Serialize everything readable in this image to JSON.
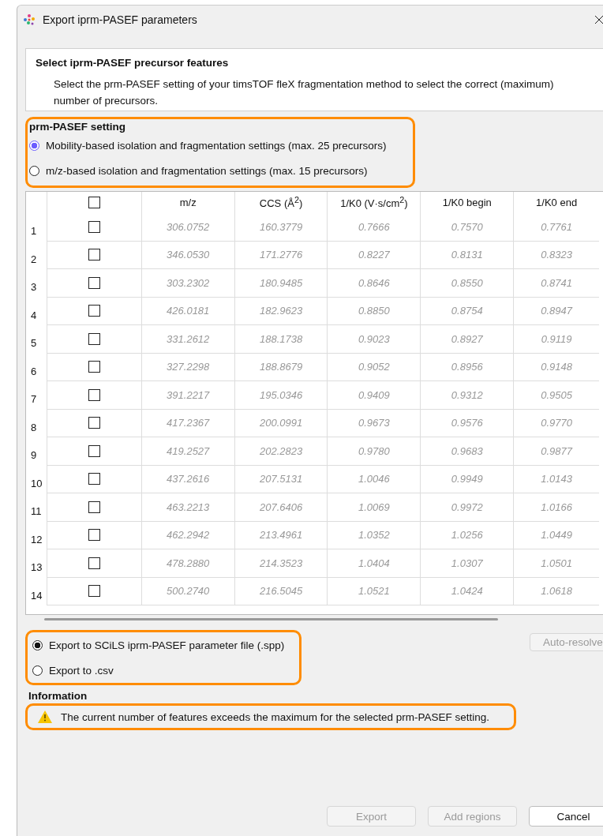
{
  "window": {
    "title": "Export iprm-PASEF parameters"
  },
  "header": {
    "title": "Select iprm-PASEF precursor features",
    "description": "Select the prm-PASEF setting of your timsTOF fleX fragmentation method to select the correct (maximum) number of precursors."
  },
  "setting": {
    "label": "prm-PASEF setting",
    "options": [
      {
        "label": "Mobility-based isolation and fragmentation settings (max. 25 precursors)",
        "selected": true
      },
      {
        "label": "m/z-based isolation and fragmentation settings (max. 15 precursors)",
        "selected": false
      }
    ]
  },
  "table": {
    "select_all_checked": false,
    "columns": [
      "m/z",
      "CCS (Å$^{2}$)",
      "1/K0 (V·s/cm$^{2}$)",
      "1/K0 begin",
      "1/K0 end"
    ],
    "rows": [
      {
        "index": "1",
        "checked": false,
        "cells": [
          "306.0752",
          "160.3779",
          "0.7666",
          "0.7570",
          "0.7761"
        ]
      },
      {
        "index": "2",
        "checked": false,
        "cells": [
          "346.0530",
          "171.2776",
          "0.8227",
          "0.8131",
          "0.8323"
        ]
      },
      {
        "index": "3",
        "checked": false,
        "cells": [
          "303.2302",
          "180.9485",
          "0.8646",
          "0.8550",
          "0.8741"
        ]
      },
      {
        "index": "4",
        "checked": false,
        "cells": [
          "426.0181",
          "182.9623",
          "0.8850",
          "0.8754",
          "0.8947"
        ]
      },
      {
        "index": "5",
        "checked": false,
        "cells": [
          "331.2612",
          "188.1738",
          "0.9023",
          "0.8927",
          "0.9119"
        ]
      },
      {
        "index": "6",
        "checked": false,
        "cells": [
          "327.2298",
          "188.8679",
          "0.9052",
          "0.8956",
          "0.9148"
        ]
      },
      {
        "index": "7",
        "checked": false,
        "cells": [
          "391.2217",
          "195.0346",
          "0.9409",
          "0.9312",
          "0.9505"
        ]
      },
      {
        "index": "8",
        "checked": false,
        "cells": [
          "417.2367",
          "200.0991",
          "0.9673",
          "0.9576",
          "0.9770"
        ]
      },
      {
        "index": "9",
        "checked": false,
        "cells": [
          "419.2527",
          "202.2823",
          "0.9780",
          "0.9683",
          "0.9877"
        ]
      },
      {
        "index": "10",
        "checked": false,
        "cells": [
          "437.2616",
          "207.5131",
          "1.0046",
          "0.9949",
          "1.0143"
        ]
      },
      {
        "index": "11",
        "checked": false,
        "cells": [
          "463.2213",
          "207.6406",
          "1.0069",
          "0.9972",
          "1.0166"
        ]
      },
      {
        "index": "12",
        "checked": false,
        "cells": [
          "462.2942",
          "213.4961",
          "1.0352",
          "1.0256",
          "1.0449"
        ]
      },
      {
        "index": "13",
        "checked": false,
        "cells": [
          "478.2880",
          "214.3523",
          "1.0404",
          "1.0307",
          "1.0501"
        ]
      },
      {
        "index": "14",
        "checked": false,
        "cells": [
          "500.2740",
          "216.5045",
          "1.0521",
          "1.0424",
          "1.0618"
        ]
      }
    ]
  },
  "export": {
    "options": [
      {
        "label": "Export to SCiLS iprm-PASEF parameter file (.spp)",
        "selected": true
      },
      {
        "label": "Export to .csv",
        "selected": false
      }
    ],
    "auto_resolve": {
      "label": "Auto-resolve",
      "disabled": true
    }
  },
  "information": {
    "label": "Information",
    "message": "The current number of features exceeds the maximum for the selected prm-PASEF setting."
  },
  "buttons": [
    {
      "label": "Export",
      "disabled": true
    },
    {
      "label": "Add regions",
      "disabled": true
    },
    {
      "label": "Cancel",
      "disabled": false
    }
  ]
}
